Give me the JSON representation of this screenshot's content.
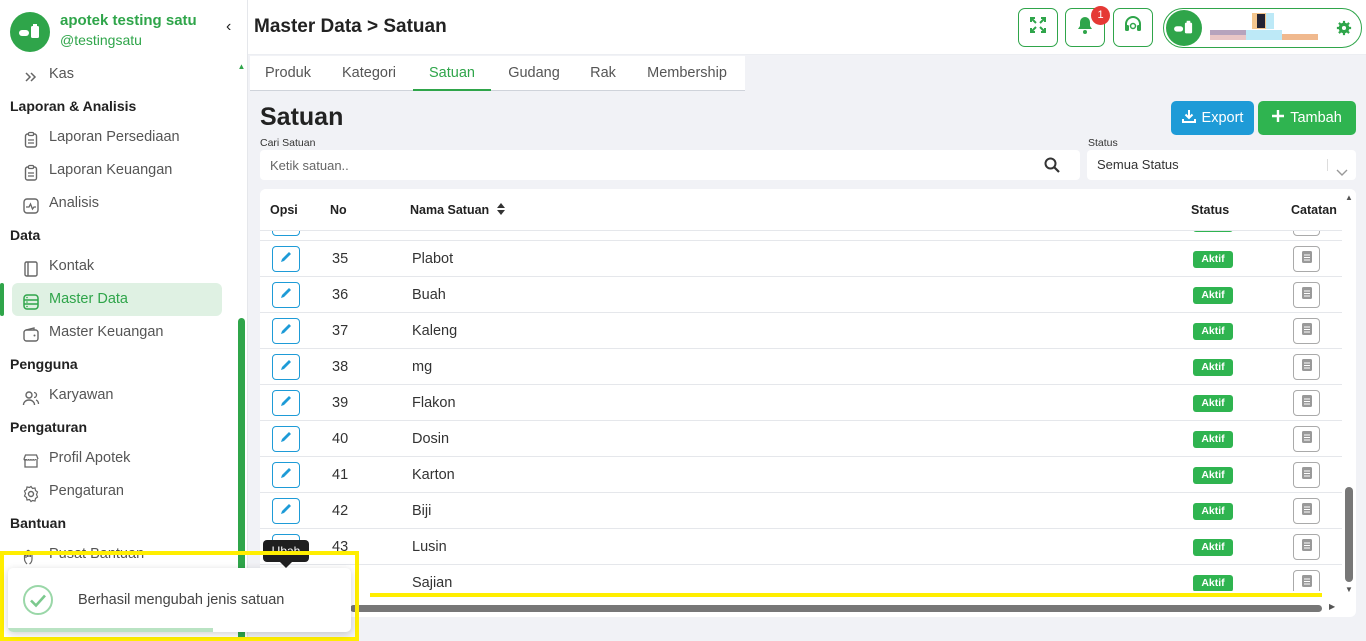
{
  "colors": {
    "primary": "#2fa54a",
    "export": "#1e9bd7",
    "add": "#2fb450",
    "badge": "#e53935",
    "highlight": "#ffee00"
  },
  "sidebar": {
    "brand_name": "apotek testing satu",
    "brand_handle": "@testingsatu",
    "collapse_icon": "‹",
    "kas": "Kas",
    "sections": {
      "laporan": "Laporan & Analisis",
      "data": "Data",
      "pengguna": "Pengguna",
      "pengaturan": "Pengaturan",
      "bantuan": "Bantuan"
    },
    "items": {
      "laporan_persediaan": "Laporan Persediaan",
      "laporan_keuangan": "Laporan Keuangan",
      "analisis": "Analisis",
      "kontak": "Kontak",
      "master_data": "Master Data",
      "master_keuangan": "Master Keuangan",
      "karyawan": "Karyawan",
      "profil_apotek": "Profil Apotek",
      "pengaturan": "Pengaturan",
      "pusat_bantuan": "Pusat Bantuan"
    }
  },
  "header": {
    "title": "Master Data > Satuan",
    "notification_count": "1"
  },
  "tabs": [
    "Produk",
    "Kategori",
    "Satuan",
    "Gudang",
    "Rak",
    "Membership"
  ],
  "content": {
    "title": "Satuan",
    "export_label": "Export",
    "add_label": "Tambah",
    "search_label": "Cari Satuan",
    "search_placeholder": "Ketik satuan..",
    "status_label": "Status",
    "status_value": "Semua Status"
  },
  "table": {
    "columns": {
      "opsi": "Opsi",
      "no": "No",
      "nama": "Nama Satuan",
      "status": "Status",
      "catatan": "Catatan"
    },
    "rows": [
      {
        "no": "35",
        "name": "Plabot",
        "status": "Aktif"
      },
      {
        "no": "36",
        "name": "Buah",
        "status": "Aktif"
      },
      {
        "no": "37",
        "name": "Kaleng",
        "status": "Aktif"
      },
      {
        "no": "38",
        "name": "mg",
        "status": "Aktif"
      },
      {
        "no": "39",
        "name": "Flakon",
        "status": "Aktif"
      },
      {
        "no": "40",
        "name": "Dosin",
        "status": "Aktif"
      },
      {
        "no": "41",
        "name": "Karton",
        "status": "Aktif"
      },
      {
        "no": "42",
        "name": "Biji",
        "status": "Aktif"
      },
      {
        "no": "43",
        "name": "Lusin",
        "status": "Aktif"
      },
      {
        "no": "",
        "name": "Sajian",
        "status": "Aktif"
      }
    ]
  },
  "tooltip": {
    "text": "Ubah"
  },
  "toast": {
    "message": "Berhasil mengubah jenis satuan"
  }
}
